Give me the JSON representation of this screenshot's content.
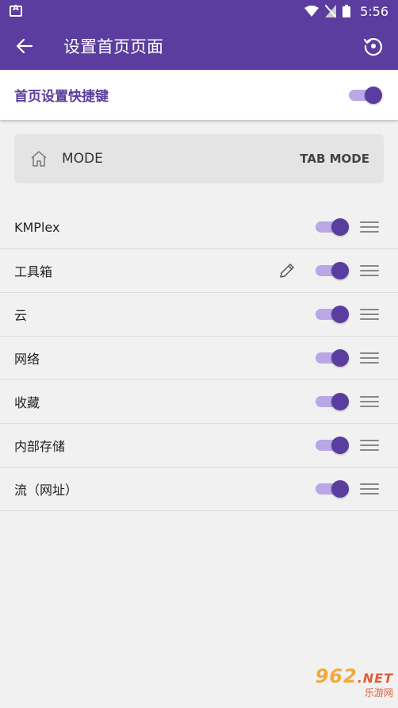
{
  "status_bar": {
    "time": "5:56"
  },
  "app_bar": {
    "title": "设置首页页面"
  },
  "shortcut": {
    "label": "首页设置快捷键",
    "enabled": true
  },
  "mode_card": {
    "label": "MODE",
    "value": "TAB MODE"
  },
  "items": [
    {
      "label": "KMPlex",
      "enabled": true,
      "editable": false
    },
    {
      "label": "工具箱",
      "enabled": true,
      "editable": true
    },
    {
      "label": "云",
      "enabled": true,
      "editable": false
    },
    {
      "label": "网络",
      "enabled": true,
      "editable": false
    },
    {
      "label": "收藏",
      "enabled": true,
      "editable": false
    },
    {
      "label": "内部存储",
      "enabled": true,
      "editable": false
    },
    {
      "label": "流（网址）",
      "enabled": true,
      "editable": false
    }
  ],
  "watermark": {
    "top": "962",
    "net": ".NET",
    "bottom": "乐游网"
  },
  "colors": {
    "primary": "#5a3d9e",
    "track": "#b9a7e6",
    "background": "#f1f1f1"
  },
  "icons": {
    "back": "arrow-left-icon",
    "restore": "restore-icon",
    "home": "home-icon",
    "edit": "pencil-icon",
    "drag": "drag-handle-icon"
  }
}
